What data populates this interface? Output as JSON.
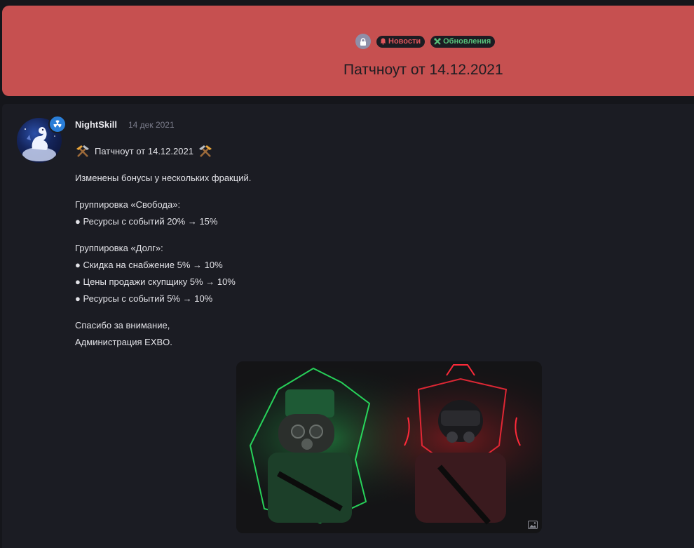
{
  "header": {
    "tags": {
      "lock_icon": "lock-icon",
      "news_label": "Новости",
      "updates_label": "Обновления"
    },
    "title": "Патчноут от 14.12.2021"
  },
  "post": {
    "author": "NightSkill",
    "date": "14 дек 2021",
    "heading": "Патчноут от 14.12.2021",
    "intro": "Изменены бонусы у нескольких фракций.",
    "svoboda": {
      "title": "Группировка «Свобода»:",
      "items": [
        "● Ресурсы с событий 20% → 15%"
      ]
    },
    "dolg": {
      "title": "Группировка «Долг»:",
      "items": [
        "● Скидка на снабжение 5% → 10%",
        "● Цены продажи скупщику 5% → 10%",
        "● Ресурсы с событий 5% → 10%"
      ]
    },
    "thanks": "Спасибо за внимание,",
    "signature": "Администрация EXBO."
  },
  "colors": {
    "header_bg": "#c65050",
    "page_bg": "#15161b",
    "post_bg": "#1b1c23",
    "news_color": "#e0565c",
    "updates_color": "#57c07a",
    "badge_color": "#2a7ed8"
  }
}
